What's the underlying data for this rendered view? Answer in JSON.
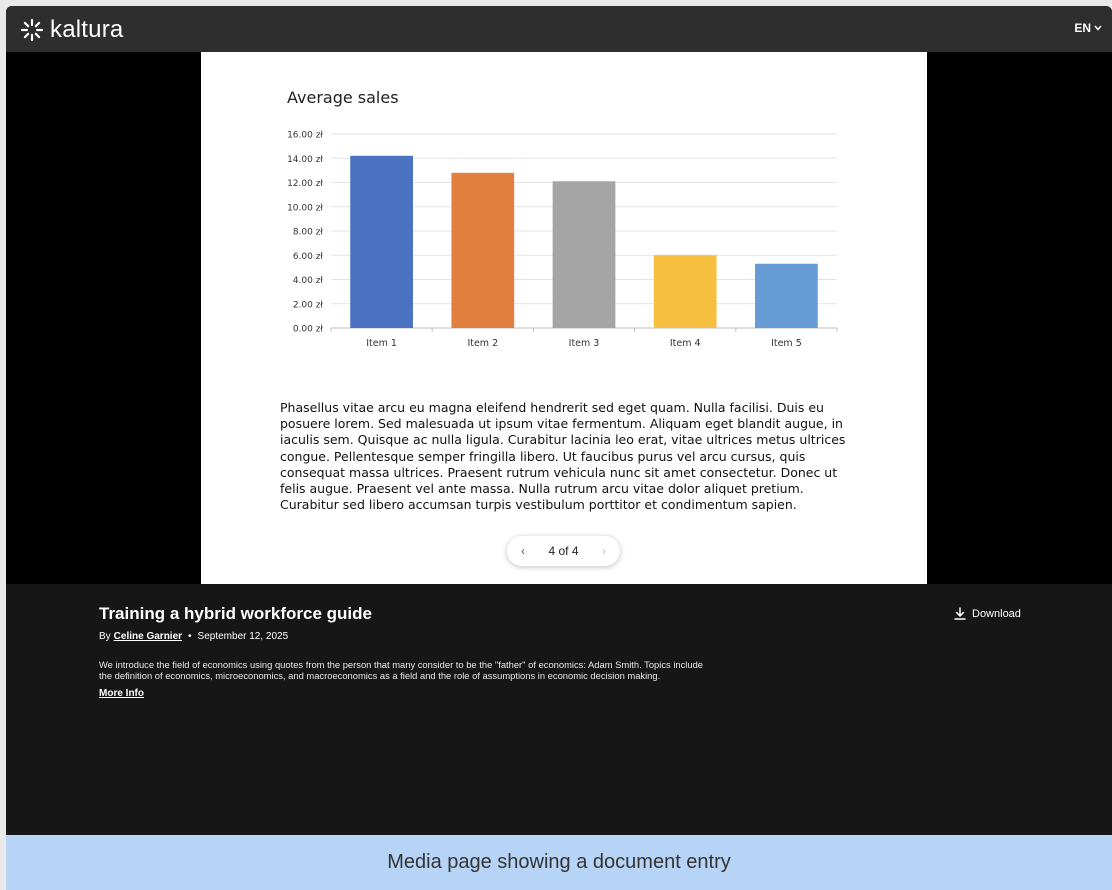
{
  "header": {
    "logo_text": "kaltura",
    "language": "EN"
  },
  "document": {
    "page_indicator": "4 of 4",
    "paragraph": "Phasellus vitae arcu eu magna eleifend hendrerit sed eget quam. Nulla facilisi. Duis eu posuere lorem. Sed malesuada ut ipsum vitae fermentum. Aliquam eget blandit augue, in iaculis sem. Quisque ac nulla ligula. Curabitur lacinia leo erat, vitae ultrices metus ultrices congue. Pellentesque semper fringilla libero. Ut faucibus purus vel arcu cursus, quis consequat massa ultrices. Praesent rutrum vehicula nunc sit amet consectetur. Donec ut felis augue. Praesent vel ante massa. Nulla rutrum arcu vitae dolor aliquet pretium. Curabitur sed libero accumsan turpis vestibulum porttitor et condimentum sapien."
  },
  "chart_data": {
    "type": "bar",
    "title": "Average sales",
    "categories": [
      "Item 1",
      "Item 2",
      "Item 3",
      "Item 4",
      "Item 5"
    ],
    "values": [
      14.2,
      12.8,
      12.1,
      6.0,
      5.3
    ],
    "colors": [
      "#4a72c0",
      "#e07f3f",
      "#a5a5a5",
      "#f6bf3f",
      "#679bd4"
    ],
    "ylim": [
      0,
      16
    ],
    "yticks": [
      "0.00 zł",
      "2.00 zł",
      "4.00 zł",
      "6.00 zł",
      "8.00 zł",
      "10.00 zł",
      "12.00 zł",
      "14.00 zł",
      "16.00 zł"
    ],
    "grid": true,
    "xlabel": "",
    "ylabel": ""
  },
  "entry": {
    "title": "Training a hybrid workforce guide",
    "by_label": "By",
    "author": "Celine Garnier",
    "date": "September 12, 2025",
    "description": "We introduce the field of economics using quotes from the person that many consider to be the \"father\" of economics: Adam Smith. Topics include the definition of economics, microeconomics, and macroeconomics as a field and the role of assumptions in economic decision making.",
    "more_info": "More Info",
    "download_label": "Download"
  },
  "caption": "Media page showing a document entry",
  "colors": {
    "topbar": "#2e2e2e",
    "background": "#161616",
    "caption_band": "#b7d4f7"
  }
}
